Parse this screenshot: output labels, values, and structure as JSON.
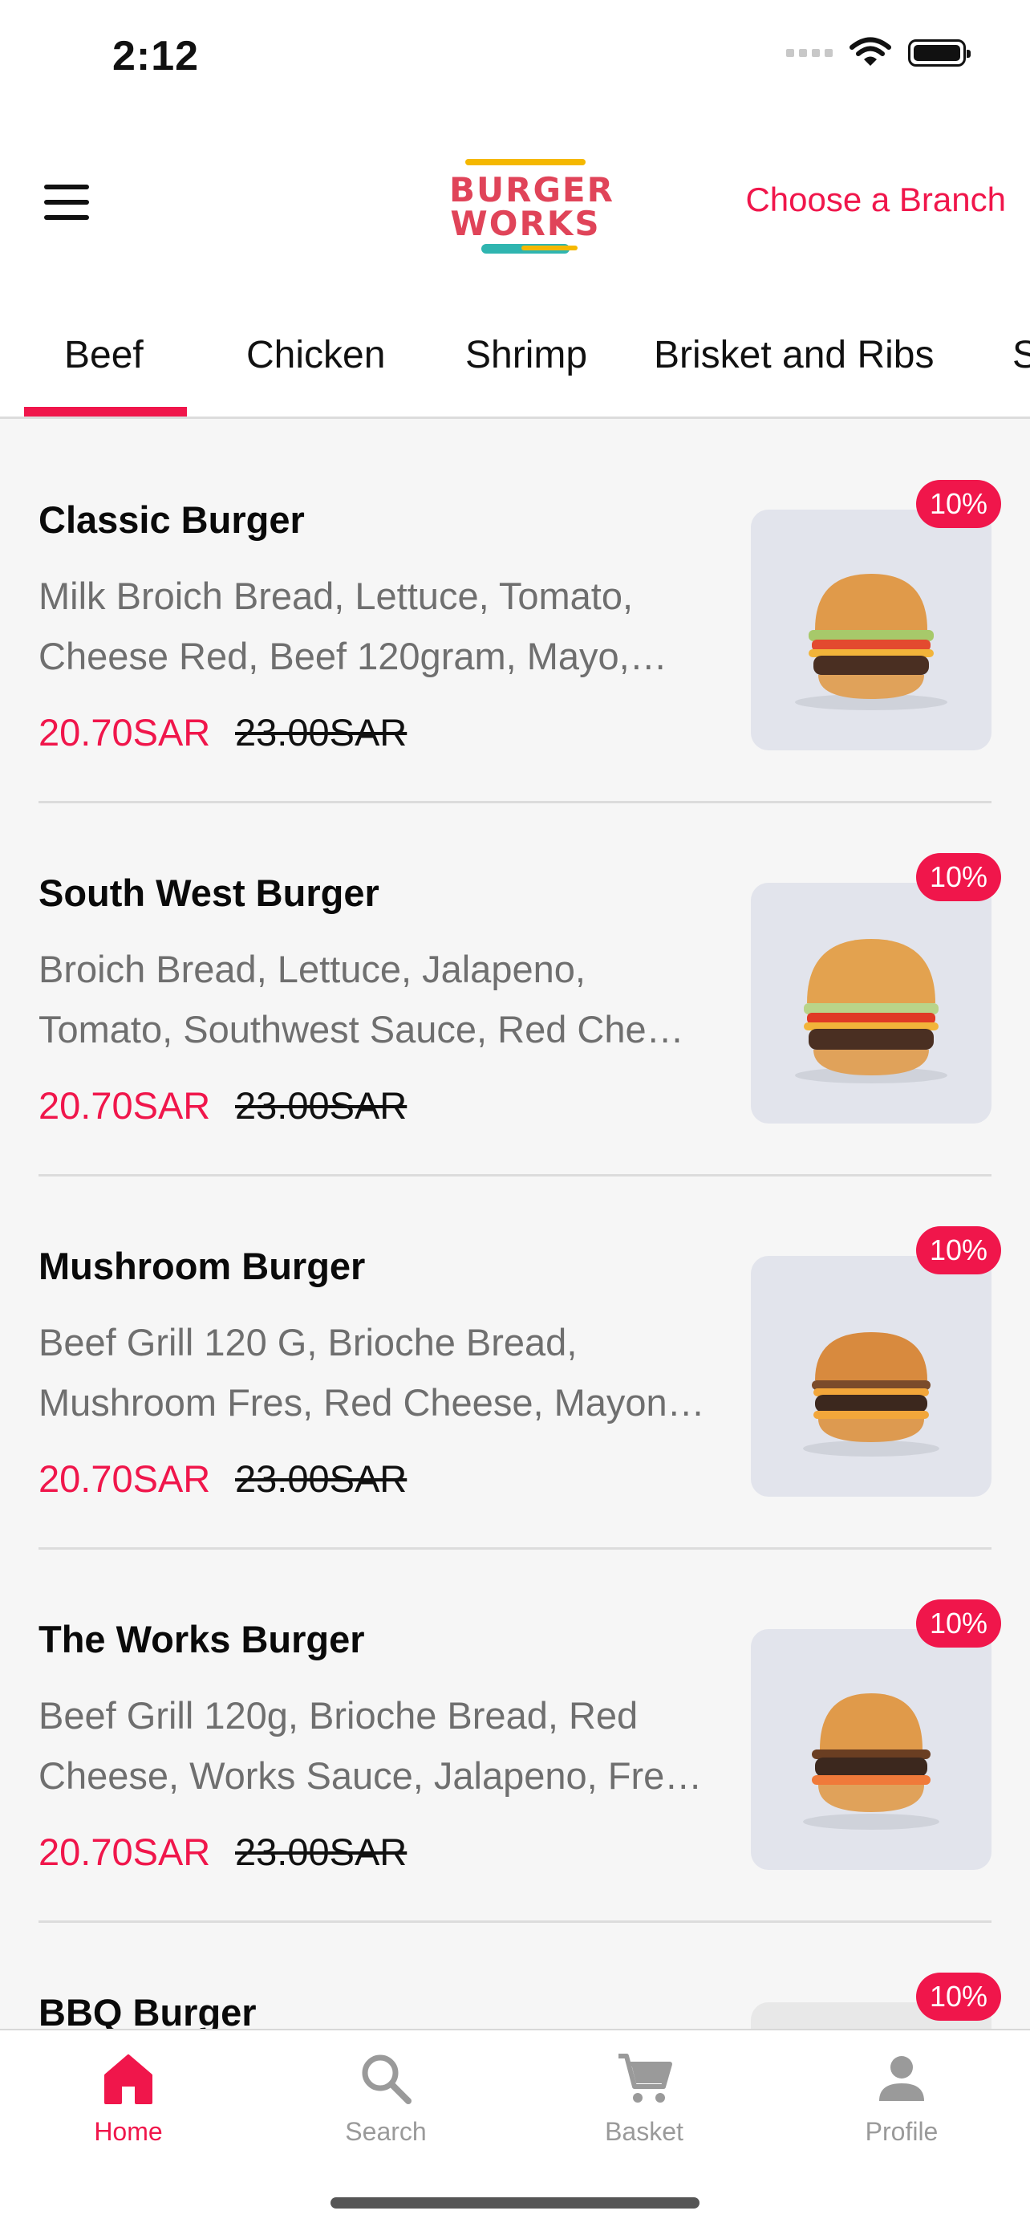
{
  "status_bar": {
    "time": "2:12"
  },
  "header": {
    "logo_line1": "BURGER",
    "logo_line2": "WORKS",
    "branch_link": "Choose a Branch"
  },
  "tabs": [
    "Beef",
    "Chicken",
    "Shrimp",
    "Brisket and Ribs",
    "S"
  ],
  "active_tab": "Beef",
  "items": [
    {
      "title": "Classic Burger",
      "desc": "Milk Broich Bread, Lettuce, Tomato, Cheese Red, Beef 120gram, Mayo,…",
      "price": "20.70SAR",
      "old_price": "23.00SAR",
      "badge": "10%"
    },
    {
      "title": "South West Burger",
      "desc": "Broich Bread, Lettuce, Jalapeno, Tomato, Southwest Sauce, Red Che…",
      "price": "20.70SAR",
      "old_price": "23.00SAR",
      "badge": "10%"
    },
    {
      "title": "Mushroom Burger",
      "desc": "Beef Grill 120 G, Brioche Bread, Mushroom Fres, Red Cheese, Mayon…",
      "price": "20.70SAR",
      "old_price": "23.00SAR",
      "badge": "10%"
    },
    {
      "title": "The Works Burger",
      "desc": "Beef Grill 120g, Brioche Bread, Red Cheese, Works Sauce, Jalapeno, Fre…",
      "price": "20.70SAR",
      "old_price": "23.00SAR",
      "badge": "10%"
    },
    {
      "title": "BBQ Burger",
      "desc": "",
      "price": "",
      "old_price": "",
      "badge": "10%"
    }
  ],
  "bottom_nav": [
    {
      "label": "Home",
      "icon": "home-icon",
      "active": true
    },
    {
      "label": "Search",
      "icon": "search-icon",
      "active": false
    },
    {
      "label": "Basket",
      "icon": "cart-icon",
      "active": false
    },
    {
      "label": "Profile",
      "icon": "profile-icon",
      "active": false
    }
  ],
  "colors": {
    "accent": "#f0164b",
    "logo_red": "#e04459",
    "logo_yellow": "#f5b800",
    "logo_teal": "#2fb5b0",
    "background": "#f6f6f6"
  }
}
